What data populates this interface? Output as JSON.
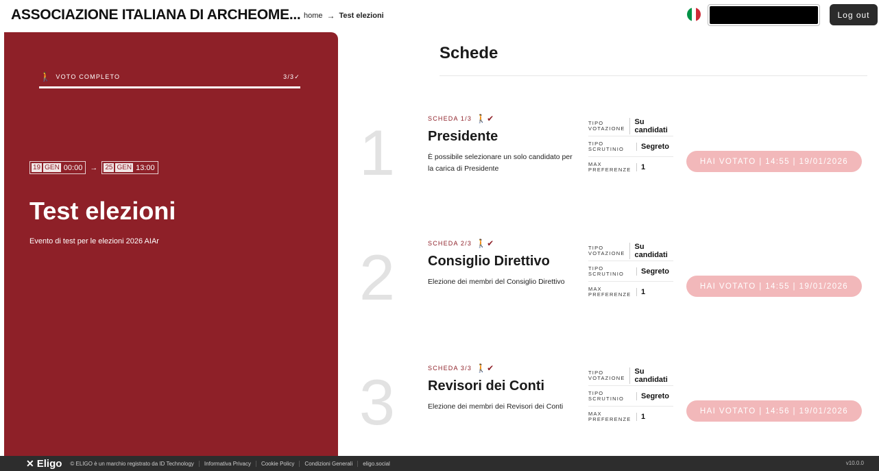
{
  "header": {
    "app_title": "ASSOCIAZIONE ITALIANA DI ARCHEOME...",
    "breadcrumb": {
      "home": "home",
      "arrow": "→",
      "current": "Test elezioni"
    },
    "flag_colors": [
      "#009246",
      "#ffffff",
      "#ce2b37"
    ],
    "logout_label": "Log out"
  },
  "left_panel": {
    "progress_icon": "walking-person-icon",
    "progress_label": "VOTO COMPLETO",
    "progress_count": "3/3✓",
    "progress_fraction": 1.0,
    "dates": {
      "start": {
        "day": "19",
        "month": "GEN",
        "time": "00:00"
      },
      "arrow": "→",
      "end": {
        "day": "25",
        "month": "GEN",
        "time": "13:00"
      }
    },
    "event_title": "Test elezioni",
    "event_description": "Evento di test per le elezioni 2026 AIAr"
  },
  "main": {
    "section_title": "Schede",
    "ballots": [
      {
        "number": "1",
        "label": "SCHEDA 1/3",
        "title": "Presidente",
        "description": "È possibile selezionare un solo candidato per la carica di Presidente",
        "specs": [
          {
            "key": "TIPO VOTAZIONE",
            "value": "Su candidati"
          },
          {
            "key": "TIPO SCRUTINIO",
            "value": "Segreto"
          },
          {
            "key": "MAX PREFERENZE",
            "value": "1"
          }
        ],
        "voted_label": "HAI VOTATO | 14:55 | 19/01/2026"
      },
      {
        "number": "2",
        "label": "SCHEDA 2/3",
        "title": "Consiglio Direttivo",
        "description": "Elezione dei membri del Consiglio Direttivo",
        "specs": [
          {
            "key": "TIPO VOTAZIONE",
            "value": "Su candidati"
          },
          {
            "key": "TIPO SCRUTINIO",
            "value": "Segreto"
          },
          {
            "key": "MAX PREFERENZE",
            "value": "1"
          }
        ],
        "voted_label": "HAI VOTATO | 14:55 | 19/01/2026"
      },
      {
        "number": "3",
        "label": "SCHEDA 3/3",
        "title": "Revisori dei Conti",
        "description": "Elezione dei membri dei Revisori dei Conti",
        "specs": [
          {
            "key": "TIPO VOTAZIONE",
            "value": "Su candidati"
          },
          {
            "key": "TIPO SCRUTINIO",
            "value": "Segreto"
          },
          {
            "key": "MAX PREFERENZE",
            "value": "1"
          }
        ],
        "voted_label": "HAI VOTATO | 14:56 | 19/01/2026"
      }
    ]
  },
  "footer": {
    "logo_text": "Eligo",
    "copyright": "© ELIGO è un marchio registrato da ID Technology",
    "links": [
      "Informativa Privacy",
      "Cookie Policy",
      "Condizioni Generali",
      "eligo.social"
    ],
    "version": "v10.0.0"
  }
}
